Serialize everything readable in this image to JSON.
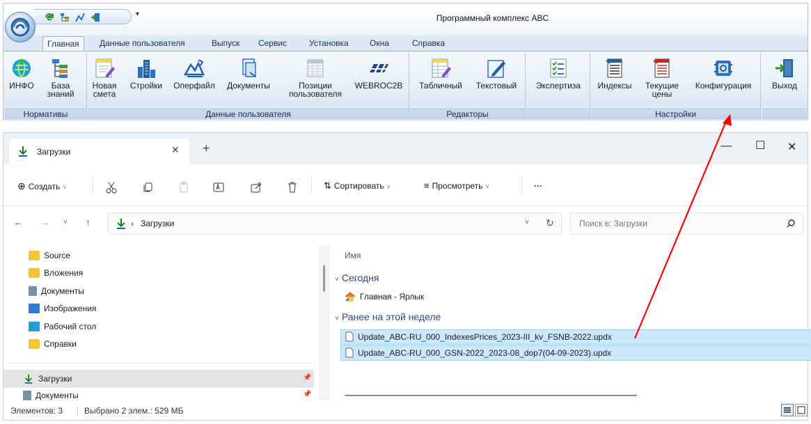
{
  "ribbon_app": {
    "title": "Программный комплекс ABC",
    "tabs": [
      {
        "label": "Главная",
        "active": true
      },
      {
        "label": "Данные пользователя"
      },
      {
        "label": "Выпуск"
      },
      {
        "label": "Сервис"
      },
      {
        "label": "Установка"
      },
      {
        "label": "Окна"
      },
      {
        "label": "Справка"
      }
    ],
    "groups": {
      "normativy": {
        "label": "Нормативы",
        "buttons": [
          {
            "label": "ИНФО",
            "icon": "info-globe-icon"
          },
          {
            "label_1": "База",
            "label_2": "знаний",
            "icon": "knowledge-base-icon"
          }
        ]
      },
      "user_data": {
        "label": "Данные пользователя",
        "buttons": [
          {
            "label_1": "Новая",
            "label_2": "смета",
            "icon": "new-estimate-icon"
          },
          {
            "label": "Стройки",
            "icon": "buildings-icon"
          },
          {
            "label": "Оперфайл",
            "icon": "operfile-icon"
          },
          {
            "label": "Документы",
            "icon": "documents-icon"
          },
          {
            "label_1": "Позиции",
            "label_2": "пользователя",
            "icon": "user-positions-icon"
          },
          {
            "label": "WEBROC2B",
            "icon": "webroc2b-icon"
          }
        ]
      },
      "editors": {
        "label": "Редакторы",
        "buttons": [
          {
            "label": "Табличный",
            "icon": "table-editor-icon"
          },
          {
            "label": "Текстовый",
            "icon": "text-editor-icon"
          }
        ]
      },
      "expertise": {
        "buttons": [
          {
            "label": "Экспертиза",
            "icon": "checklist-icon"
          }
        ]
      },
      "settings": {
        "label": "Настройки",
        "buttons": [
          {
            "label": "Индексы",
            "icon": "indexes-icon"
          },
          {
            "label_1": "Текущие",
            "label_2": "цены",
            "icon": "current-prices-icon"
          },
          {
            "label": "Конфигурация",
            "icon": "configuration-icon"
          }
        ]
      },
      "exit": {
        "buttons": [
          {
            "label": "Выход",
            "icon": "exit-door-icon"
          }
        ]
      }
    }
  },
  "explorer": {
    "tab_title": "Загрузки",
    "toolbar": {
      "create": "Создать",
      "sort": "Сортировать",
      "view": "Просмотреть",
      "more": "···"
    },
    "address": {
      "separator": "›",
      "path": "Загрузки",
      "search_placeholder": "Поиск в: Загрузки"
    },
    "nav": {
      "items": [
        {
          "label": "Source",
          "icon": "folder-icon"
        },
        {
          "label": "Вложения",
          "icon": "folder-icon"
        },
        {
          "label": "Документы",
          "icon": "documents-icon"
        },
        {
          "label": "Изображения",
          "icon": "pictures-icon"
        },
        {
          "label": "Рабочий стол",
          "icon": "desktop-icon"
        },
        {
          "label": "Справки",
          "icon": "folder-icon"
        }
      ],
      "pinned": [
        {
          "label": "Загрузки",
          "icon": "downloads-icon",
          "selected": true
        },
        {
          "label": "Документы",
          "icon": "documents-icon"
        }
      ]
    },
    "content": {
      "column_name": "Имя",
      "groups": [
        {
          "label": "Сегодня",
          "files": [
            {
              "name": "Главная - Ярлык",
              "icon": "home-shortcut-icon",
              "selected": false
            }
          ]
        },
        {
          "label": "Ранее на этой неделе",
          "files": [
            {
              "name": "Update_ABC-RU_000_IndexesPrices_2023-III_kv_FSNB-2022.updx",
              "icon": "file-icon",
              "selected": true
            },
            {
              "name": "Update_ABC-RU_000_GSN-2022_2023-08_dop7(04-09-2023).updx",
              "icon": "file-icon",
              "selected": true
            }
          ]
        }
      ]
    },
    "status": {
      "count": "Элементов: 3",
      "selection": "Выбрано 2 элем.: 529 МБ"
    }
  },
  "annotation": {
    "arrow_color": "#ff0000"
  }
}
